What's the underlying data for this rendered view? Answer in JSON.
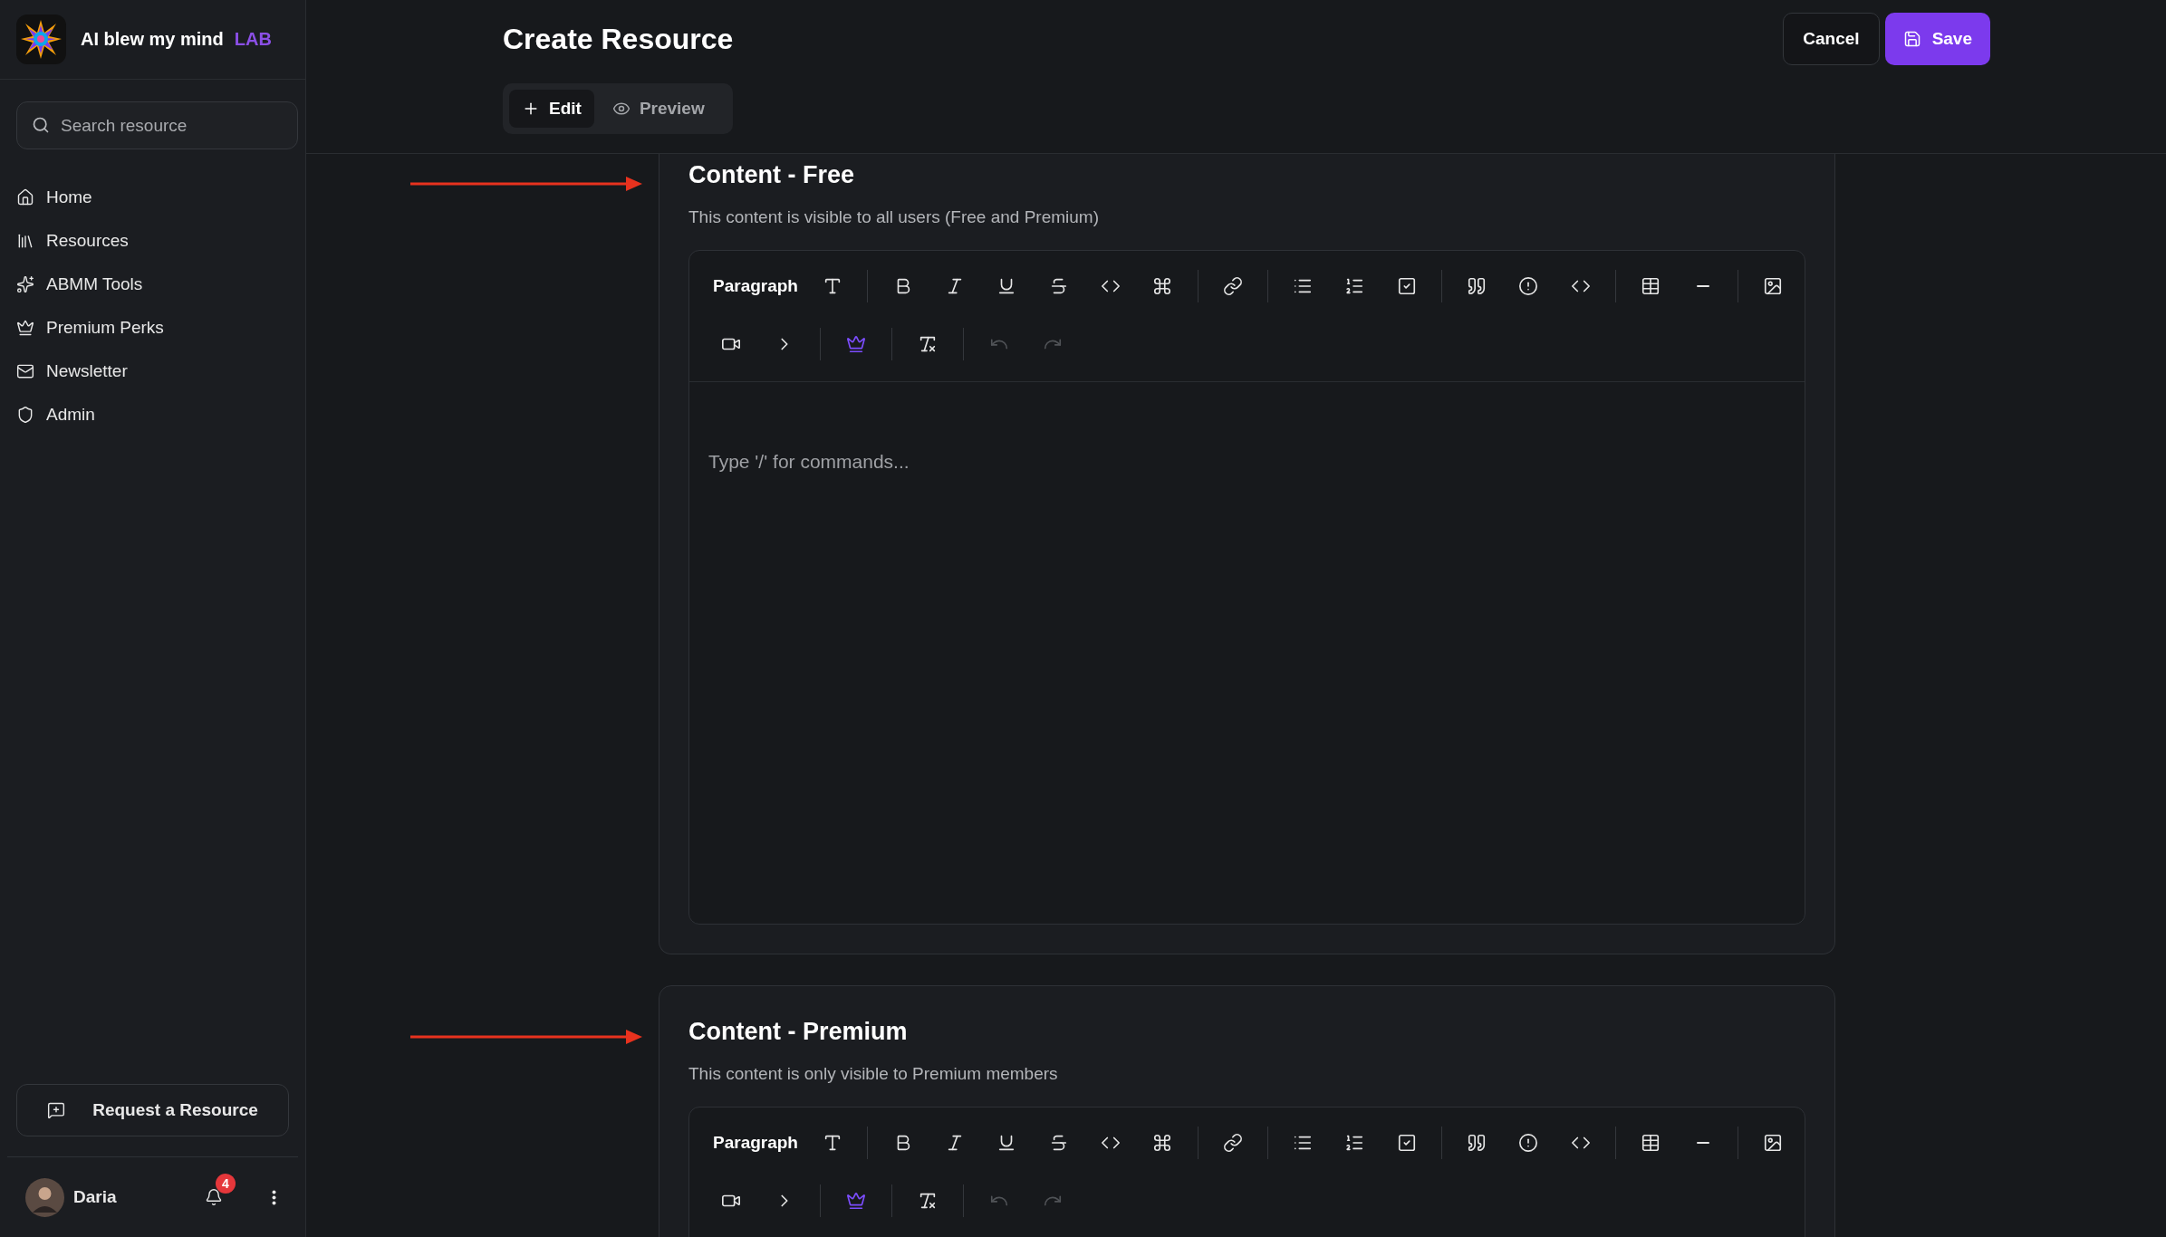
{
  "sidebar": {
    "brand": {
      "name": "AI blew my mind",
      "tag": "LAB"
    },
    "search": {
      "placeholder": "Search resource"
    },
    "nav": [
      {
        "label": "Home"
      },
      {
        "label": "Resources"
      },
      {
        "label": "ABMM Tools"
      },
      {
        "label": "Premium Perks"
      },
      {
        "label": "Newsletter"
      },
      {
        "label": "Admin"
      }
    ],
    "request_button": "Request a Resource",
    "user": {
      "name": "Daria",
      "notifications": "4"
    }
  },
  "header": {
    "title": "Create Resource",
    "tabs": [
      {
        "label": "Edit",
        "selected": true
      },
      {
        "label": "Preview",
        "selected": false
      }
    ],
    "cancel": "Cancel",
    "save": "Save"
  },
  "sections": [
    {
      "title": "Content - Free",
      "description": "This content is visible to all users (Free and Premium)",
      "editor": {
        "block_type": "Paragraph",
        "placeholder": "Type '/' for commands...",
        "buttons": [
          {
            "active": false,
            "disabled": false
          },
          {
            "active": false,
            "disabled": false
          },
          {
            "active": false,
            "disabled": false
          },
          {
            "active": false,
            "disabled": false
          },
          {
            "active": false,
            "disabled": false
          },
          {
            "active": false,
            "disabled": false
          },
          {
            "active": false,
            "disabled": false
          },
          {
            "active": false,
            "disabled": false
          },
          {
            "active": false,
            "disabled": false
          },
          {
            "active": false,
            "disabled": false
          },
          {
            "active": false,
            "disabled": false
          },
          {
            "active": false,
            "disabled": false
          },
          {
            "active": false,
            "disabled": false
          },
          {
            "active": false,
            "disabled": false
          },
          {
            "active": false,
            "disabled": false
          },
          {
            "active": false,
            "disabled": false
          },
          {
            "active": false,
            "disabled": false
          },
          {
            "active": false,
            "disabled": false
          },
          {
            "active": false,
            "disabled": false
          },
          {
            "active": true,
            "disabled": false
          },
          {
            "active": false,
            "disabled": false
          },
          {
            "active": false,
            "disabled": true
          },
          {
            "active": false,
            "disabled": true
          }
        ]
      }
    },
    {
      "title": "Content - Premium",
      "description": "This content is only visible to Premium members",
      "editor": {
        "block_type": "Paragraph",
        "buttons": [
          {
            "active": false,
            "disabled": false
          },
          {
            "active": false,
            "disabled": false
          },
          {
            "active": false,
            "disabled": false
          },
          {
            "active": false,
            "disabled": false
          },
          {
            "active": false,
            "disabled": false
          },
          {
            "active": false,
            "disabled": false
          },
          {
            "active": false,
            "disabled": false
          },
          {
            "active": false,
            "disabled": false
          },
          {
            "active": false,
            "disabled": false
          },
          {
            "active": false,
            "disabled": false
          },
          {
            "active": false,
            "disabled": false
          },
          {
            "active": false,
            "disabled": false
          },
          {
            "active": false,
            "disabled": false
          },
          {
            "active": false,
            "disabled": false
          },
          {
            "active": false,
            "disabled": false
          },
          {
            "active": false,
            "disabled": false
          },
          {
            "active": false,
            "disabled": false
          },
          {
            "active": false,
            "disabled": false
          },
          {
            "active": false,
            "disabled": false
          },
          {
            "active": true,
            "disabled": false
          },
          {
            "active": false,
            "disabled": false
          },
          {
            "active": false,
            "disabled": true
          },
          {
            "active": false,
            "disabled": true
          }
        ]
      }
    }
  ]
}
